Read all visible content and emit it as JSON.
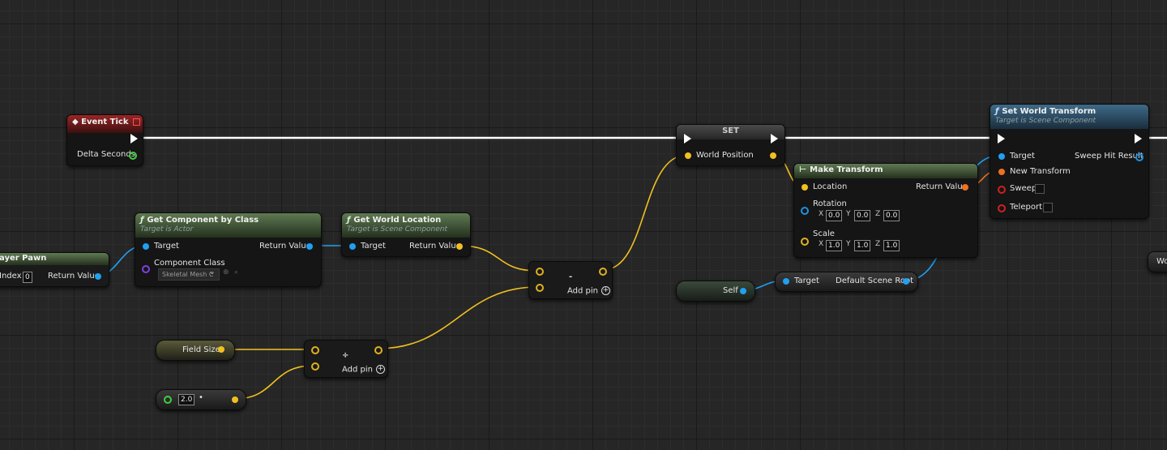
{
  "nodes": {
    "event_tick": {
      "title": "Event Tick",
      "delta_seconds": "Delta Seconds"
    },
    "player_pawn": {
      "title": "ayer Pawn",
      "index_label": "Index",
      "index_value": "0",
      "return_value": "Return Value"
    },
    "get_component": {
      "title": "Get Component by Class",
      "subtitle": "Target is Actor",
      "target": "Target",
      "return_value": "Return Value",
      "component_class": "Component Class",
      "class_value": "Skeletal Mesh C"
    },
    "get_world_location": {
      "title": "Get World Location",
      "subtitle": "Target is Scene Component",
      "target": "Target",
      "return_value": "Return Value"
    },
    "subtract": {
      "symbol": "-",
      "add_pin": "Add pin"
    },
    "divide": {
      "symbol": "÷",
      "add_pin": "Add pin"
    },
    "field_size": {
      "label": "Field Size"
    },
    "float_literal": {
      "value": "2.0",
      "mark": "•"
    },
    "set_node": {
      "title": "SET",
      "world_position": "World Position"
    },
    "make_transform": {
      "title": "Make Transform",
      "location": "Location",
      "return_value": "Return Value",
      "rotation": "Rotation",
      "scale": "Scale",
      "rot_x": "0.0",
      "rot_y": "0.0",
      "rot_z": "0.0",
      "scale_x": "1.0",
      "scale_y": "1.0",
      "scale_z": "1.0",
      "ax_x": "X",
      "ax_y": "Y",
      "ax_z": "Z"
    },
    "self_node": {
      "label": "Self"
    },
    "default_scene_root": {
      "target": "Target",
      "label": "Default Scene Root"
    },
    "set_world_transform": {
      "title": "Set World Transform",
      "subtitle": "Target is Scene Component",
      "target": "Target",
      "new_transform": "New Transform",
      "sweep": "Sweep",
      "teleport": "Teleport",
      "sweep_hit_result": "Sweep Hit Result"
    },
    "edge_node": {
      "label": "Wo"
    }
  },
  "colors": {
    "exec": "#ffffff",
    "vector": "#f0c020",
    "object": "#20a0f0",
    "transform": "#f07020",
    "float": "#40d040",
    "bool": "#d02020"
  }
}
